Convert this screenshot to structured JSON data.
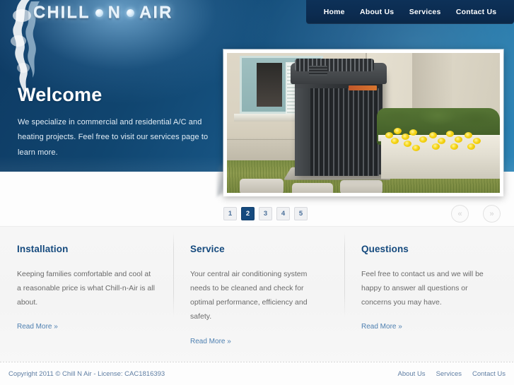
{
  "site": {
    "logo": {
      "part1": "CHILL",
      "part2": "N",
      "part3": "AIR"
    }
  },
  "nav": {
    "items": [
      {
        "label": "Home"
      },
      {
        "label": "About Us"
      },
      {
        "label": "Services"
      },
      {
        "label": "Contact Us"
      }
    ]
  },
  "hero": {
    "heading": "Welcome",
    "body": "We specialize in commercial and residential A/C and heating projects. Feel free to visit our services page to learn more.",
    "image_alt": "Outdoor air conditioning condenser unit beside a house with yellow flowers"
  },
  "slider": {
    "pages": [
      "1",
      "2",
      "3",
      "4",
      "5"
    ],
    "active_page": "2",
    "prev_label": "«",
    "next_label": "»"
  },
  "columns": [
    {
      "title": "Installation",
      "body": "Keeping families comfortable and cool at a reasonable price is what Chill-n-Air is all about.",
      "link": "Read More »"
    },
    {
      "title": "Service",
      "body": "Your central air conditioning system needs to be cleaned and check for optimal performance, efficiency and safety.",
      "link": "Read More »"
    },
    {
      "title": "Questions",
      "body": "Feel free to contact us and we will be happy to answer all questions or concerns you may have.",
      "link": "Read More »"
    }
  ],
  "footer": {
    "copyright": "Copyright 2011 © Chill N Air - License: CAC1816393",
    "links": [
      {
        "label": "About Us"
      },
      {
        "label": "Services"
      },
      {
        "label": "Contact Us"
      }
    ]
  },
  "colors": {
    "brand_dark_blue": "#0d3158",
    "brand_blue": "#154a7e",
    "hero_gradient_start": "#0e3a63",
    "hero_gradient_end": "#2f86b8",
    "link_blue": "#4d7fb0",
    "panel_bg": "#f5f5f5"
  }
}
